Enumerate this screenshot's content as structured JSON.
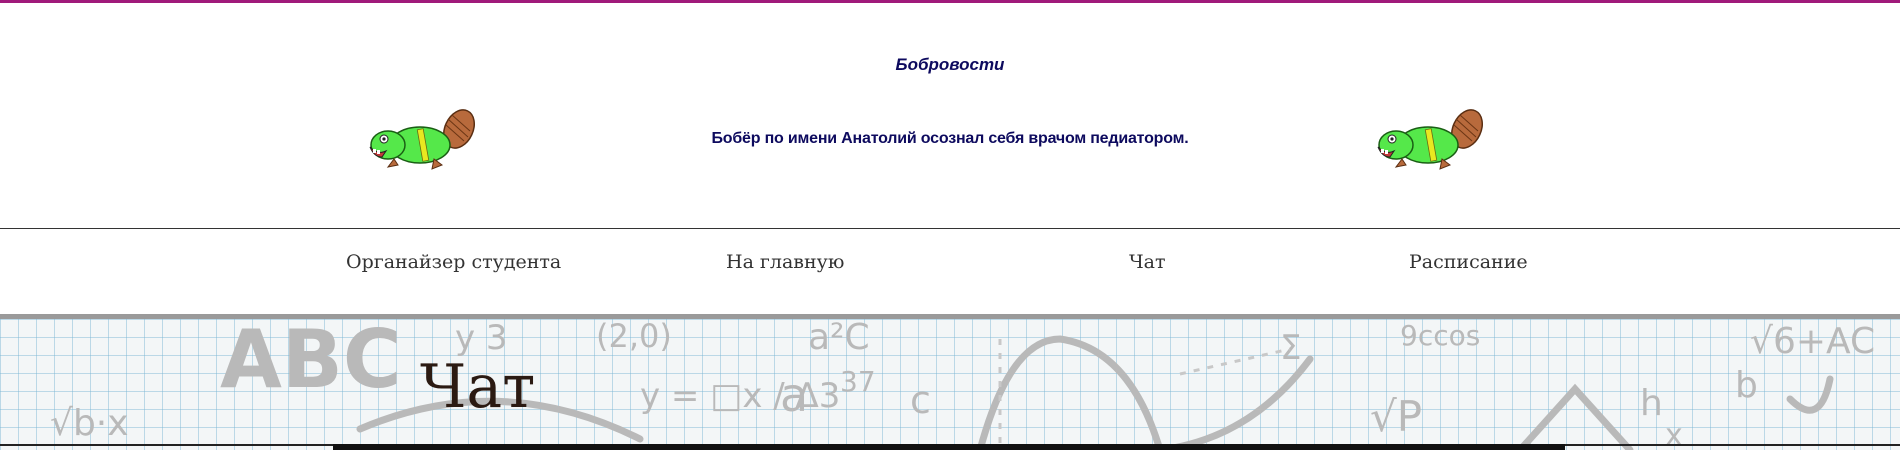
{
  "news": {
    "title": "Бобровости",
    "text": "Бобёр по имени Анатолий осознал себя врачом педиатором."
  },
  "nav": {
    "items": [
      {
        "label": "Органайзер студента"
      },
      {
        "label": "На главную"
      },
      {
        "label": "Чат"
      },
      {
        "label": "Расписание"
      }
    ]
  },
  "page": {
    "title": "Чат"
  },
  "banner_doodles": [
    "ABC",
    "y 3",
    "(2,0)",
    "a²C",
    "9ccos",
    "√6+AC",
    "√b·x",
    "y = □x / Δ3",
    "a",
    "37",
    "c",
    "√P",
    "h",
    "b",
    "x",
    "Σ"
  ],
  "colors": {
    "accent_line": "#a01a7a",
    "news_text": "#0d0a5e",
    "nav_text": "#333333",
    "beaver_body": "#55e84a",
    "beaver_tail": "#b86a3c"
  }
}
